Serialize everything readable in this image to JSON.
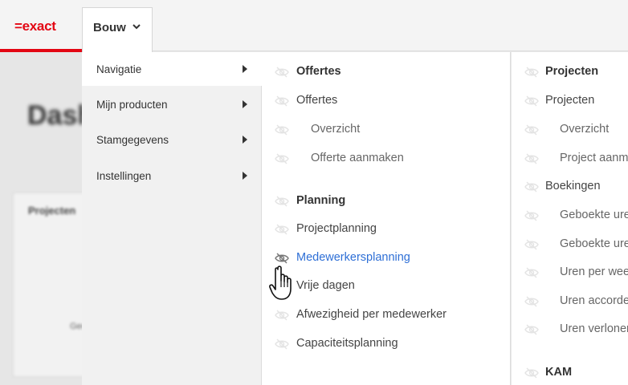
{
  "header": {
    "logo_text": "=exact",
    "module_button": "Bouw"
  },
  "background": {
    "page_title": "Dashboard",
    "card_title": "Projecten",
    "card_text": "Geen"
  },
  "menu": {
    "level1": [
      {
        "label": "Navigatie"
      },
      {
        "label": "Mijn producten"
      },
      {
        "label": "Stamgegevens"
      },
      {
        "label": "Instellingen"
      }
    ],
    "col2": {
      "offertes_heading": "Offertes",
      "offertes": "Offertes",
      "overzicht": "Overzicht",
      "offerte_aanmaken": "Offerte aanmaken",
      "planning_heading": "Planning",
      "projectplanning": "Projectplanning",
      "medewerkersplanning": "Medewerkersplanning",
      "vrije_dagen": "Vrije dagen",
      "afwezigheid": "Afwezigheid per medewerker",
      "capaciteitsplanning": "Capaciteitsplanning"
    },
    "col3": {
      "projecten_heading": "Projecten",
      "projecten": "Projecten",
      "overzicht": "Overzicht",
      "project_aanmaken": "Project aanmaken",
      "boekingen": "Boekingen",
      "geboekte_1": "Geboekte uren",
      "geboekte_2": "Geboekte uren",
      "uren_per_week": "Uren per week",
      "uren_accorderen": "Uren accorderen",
      "uren_verlonen": "Uren verlonen",
      "kam_heading": "KAM"
    }
  },
  "colors": {
    "brand": "#e30613",
    "link": "#2e6fd6"
  }
}
